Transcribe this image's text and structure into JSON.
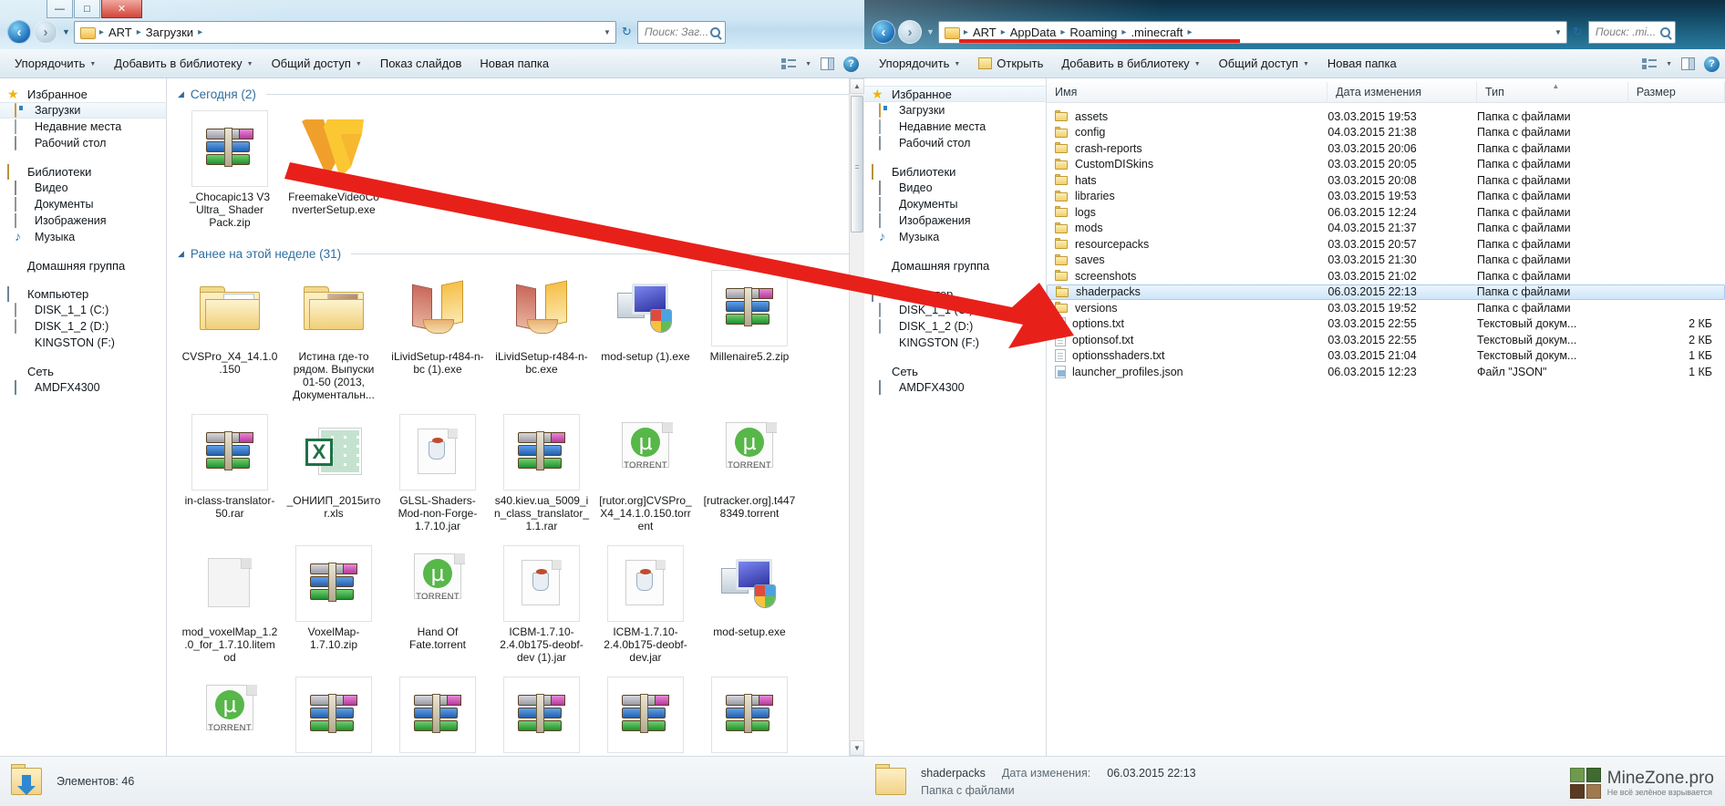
{
  "left_window": {
    "address": {
      "crumbs": [
        "ART",
        "Загрузки"
      ],
      "folder_icon": "downloads-folder-icon"
    },
    "search": {
      "placeholder": "Поиск: Заг..."
    },
    "caption": {
      "minimize": "—",
      "maximize": "□",
      "close": "✕"
    },
    "toolbar": [
      {
        "label": "Упорядочить",
        "has_caret": true
      },
      {
        "label": "Добавить в библиотеку",
        "has_caret": true
      },
      {
        "label": "Общий доступ",
        "has_caret": true
      },
      {
        "label": "Показ слайдов",
        "has_caret": false
      },
      {
        "label": "Новая папка",
        "has_caret": false
      }
    ],
    "sidebar": [
      {
        "label": "Избранное",
        "icon": "star-icon",
        "head": true
      },
      {
        "label": "Загрузки",
        "icon": "downloads-icon",
        "selected": true
      },
      {
        "label": "Недавние места",
        "icon": "recent-places-icon"
      },
      {
        "label": "Рабочий стол",
        "icon": "desktop-icon"
      },
      {
        "gap": true
      },
      {
        "label": "Библиотеки",
        "icon": "libraries-icon",
        "head": true
      },
      {
        "label": "Видео",
        "icon": "video-icon"
      },
      {
        "label": "Документы",
        "icon": "documents-icon"
      },
      {
        "label": "Изображения",
        "icon": "pictures-icon"
      },
      {
        "label": "Музыка",
        "icon": "music-icon"
      },
      {
        "gap": true
      },
      {
        "label": "Домашняя группа",
        "icon": "homegroup-icon",
        "head": true
      },
      {
        "gap": true
      },
      {
        "label": "Компьютер",
        "icon": "computer-icon",
        "head": true
      },
      {
        "label": "DISK_1_1 (C:)",
        "icon": "system-drive-icon"
      },
      {
        "label": "DISK_1_2 (D:)",
        "icon": "hard-drive-icon"
      },
      {
        "label": "KINGSTON (F:)",
        "icon": "usb-drive-icon"
      },
      {
        "gap": true
      },
      {
        "label": "Сеть",
        "icon": "network-icon",
        "head": true
      },
      {
        "label": "AMDFX4300",
        "icon": "network-computer-icon"
      }
    ],
    "groups": [
      {
        "title": "Сегодня (2)",
        "items": [
          {
            "name": "_Chocapic13 V3 Ultra_ Shader Pack.zip",
            "icon": "rar-archive-icon",
            "framed": true
          },
          {
            "name": "FreemakeVideoConverterSetup.exe",
            "icon": "freemake-icon",
            "framed": false
          }
        ]
      },
      {
        "title": "Ранее на этой неделе (31)",
        "items": [
          {
            "name": "CVSPro_X4_14.1.0.150",
            "icon": "folder-icon",
            "framed": false
          },
          {
            "name": "Истина где-то рядом. Выпуски 01-50 (2013, Документальн...",
            "icon": "folder-icon",
            "framed": false
          },
          {
            "name": "iLividSetup-r484-n-bc (1).exe",
            "icon": "film-icon",
            "framed": false
          },
          {
            "name": "iLividSetup-r484-n-bc.exe",
            "icon": "film-icon",
            "framed": false
          },
          {
            "name": "mod-setup (1).exe",
            "icon": "installer-icon",
            "framed": false
          },
          {
            "name": "Millenaire5.2.zip",
            "icon": "rar-archive-icon",
            "framed": true
          },
          {
            "name": "in-class-translator-50.rar",
            "icon": "rar-archive-icon",
            "framed": true
          },
          {
            "name": "_ОНИИП_2015итor.xls",
            "icon": "excel-icon",
            "framed": false
          },
          {
            "name": "GLSL-Shaders-Mod-non-Forge-1.7.10.jar",
            "icon": "jar-icon",
            "framed": true
          },
          {
            "name": "s40.kiev.ua_5009_in_class_translator_1.1.rar",
            "icon": "rar-archive-icon",
            "framed": true
          },
          {
            "name": "[rutor.org]CVSPro_X4_14.1.0.150.torrent",
            "icon": "torrent-icon",
            "framed": false
          },
          {
            "name": "[rutracker.org].t4478349.torrent",
            "icon": "torrent-icon",
            "framed": false
          },
          {
            "name": "mod_voxelMap_1.2.0_for_1.7.10.litemod",
            "icon": "blank-file-icon",
            "framed": false
          },
          {
            "name": "VoxelMap-1.7.10.zip",
            "icon": "rar-archive-icon",
            "framed": true
          },
          {
            "name": "Hand Of Fate.torrent",
            "icon": "torrent-icon",
            "framed": false
          },
          {
            "name": "ICBM-1.7.10-2.4.0b175-deobf-dev (1).jar",
            "icon": "jar-icon",
            "framed": true
          },
          {
            "name": "ICBM-1.7.10-2.4.0b175-deobf-dev.jar",
            "icon": "jar-icon",
            "framed": true
          },
          {
            "name": "mod-setup.exe",
            "icon": "installer-icon",
            "framed": false
          },
          {
            "name": "",
            "icon": "torrent-icon",
            "framed": false
          },
          {
            "name": "",
            "icon": "rar-archive-icon",
            "framed": true
          },
          {
            "name": "",
            "icon": "rar-archive-icon",
            "framed": true
          },
          {
            "name": "",
            "icon": "rar-archive-icon",
            "framed": true
          },
          {
            "name": "",
            "icon": "rar-archive-icon",
            "framed": true
          },
          {
            "name": "",
            "icon": "rar-archive-icon",
            "framed": true
          }
        ]
      }
    ],
    "status": {
      "text": "Элементов: 46",
      "icon": "downloads-folder-icon"
    }
  },
  "right_window": {
    "address": {
      "crumbs": [
        "ART",
        "AppData",
        "Roaming",
        ".minecraft"
      ],
      "highlighted": true
    },
    "search": {
      "placeholder": "Поиск: .mi..."
    },
    "toolbar": [
      {
        "label": "Упорядочить",
        "has_caret": true
      },
      {
        "label": "Открыть",
        "has_caret": false,
        "icon": "open-folder-icon"
      },
      {
        "label": "Добавить в библиотеку",
        "has_caret": true
      },
      {
        "label": "Общий доступ",
        "has_caret": true
      },
      {
        "label": "Новая папка",
        "has_caret": false
      }
    ],
    "sidebar": [
      {
        "label": "Избранное",
        "icon": "star-icon",
        "head": true,
        "selected": true
      },
      {
        "label": "Загрузки",
        "icon": "downloads-icon"
      },
      {
        "label": "Недавние места",
        "icon": "recent-places-icon"
      },
      {
        "label": "Рабочий стол",
        "icon": "desktop-icon"
      },
      {
        "gap": true
      },
      {
        "label": "Библиотеки",
        "icon": "libraries-icon",
        "head": true
      },
      {
        "label": "Видео",
        "icon": "video-icon"
      },
      {
        "label": "Документы",
        "icon": "documents-icon"
      },
      {
        "label": "Изображения",
        "icon": "pictures-icon"
      },
      {
        "label": "Музыка",
        "icon": "music-icon"
      },
      {
        "gap": true
      },
      {
        "label": "Домашняя группа",
        "icon": "homegroup-icon",
        "head": true
      },
      {
        "gap": true
      },
      {
        "label": "Компьютер",
        "icon": "computer-icon",
        "head": true
      },
      {
        "label": "DISK_1_1 (C:)",
        "icon": "system-drive-icon"
      },
      {
        "label": "DISK_1_2 (D:)",
        "icon": "hard-drive-icon"
      },
      {
        "label": "KINGSTON (F:)",
        "icon": "usb-drive-icon"
      },
      {
        "gap": true
      },
      {
        "label": "Сеть",
        "icon": "network-icon",
        "head": true
      },
      {
        "label": "AMDFX4300",
        "icon": "network-computer-icon"
      }
    ],
    "columns": [
      "Имя",
      "Дата изменения",
      "Тип",
      "Размер"
    ],
    "rows": [
      {
        "name": "assets",
        "icon": "folder-icon",
        "date": "03.03.2015 19:53",
        "type": "Папка с файлами",
        "size": ""
      },
      {
        "name": "config",
        "icon": "folder-icon",
        "date": "04.03.2015 21:38",
        "type": "Папка с файлами",
        "size": ""
      },
      {
        "name": "crash-reports",
        "icon": "folder-icon",
        "date": "03.03.2015 20:06",
        "type": "Папка с файлами",
        "size": ""
      },
      {
        "name": "CustomDISkins",
        "icon": "folder-icon",
        "date": "03.03.2015 20:05",
        "type": "Папка с файлами",
        "size": ""
      },
      {
        "name": "hats",
        "icon": "folder-icon",
        "date": "03.03.2015 20:08",
        "type": "Папка с файлами",
        "size": ""
      },
      {
        "name": "libraries",
        "icon": "folder-icon",
        "date": "03.03.2015 19:53",
        "type": "Папка с файлами",
        "size": ""
      },
      {
        "name": "logs",
        "icon": "folder-icon",
        "date": "06.03.2015 12:24",
        "type": "Папка с файлами",
        "size": ""
      },
      {
        "name": "mods",
        "icon": "folder-icon",
        "date": "04.03.2015 21:37",
        "type": "Папка с файлами",
        "size": ""
      },
      {
        "name": "resourcepacks",
        "icon": "folder-icon",
        "date": "03.03.2015 20:57",
        "type": "Папка с файлами",
        "size": ""
      },
      {
        "name": "saves",
        "icon": "folder-icon",
        "date": "03.03.2015 21:30",
        "type": "Папка с файлами",
        "size": ""
      },
      {
        "name": "screenshots",
        "icon": "folder-icon",
        "date": "03.03.2015 21:02",
        "type": "Папка с файлами",
        "size": ""
      },
      {
        "name": "shaderpacks",
        "icon": "folder-icon",
        "date": "06.03.2015 22:13",
        "type": "Папка с файлами",
        "size": "",
        "selected": true
      },
      {
        "name": "versions",
        "icon": "folder-icon",
        "date": "03.03.2015 19:52",
        "type": "Папка с файлами",
        "size": ""
      },
      {
        "name": "options.txt",
        "icon": "text-file-icon",
        "date": "03.03.2015 22:55",
        "type": "Текстовый докум...",
        "size": "2 КБ"
      },
      {
        "name": "optionsof.txt",
        "icon": "text-file-icon",
        "date": "03.03.2015 22:55",
        "type": "Текстовый докум...",
        "size": "2 КБ"
      },
      {
        "name": "optionsshaders.txt",
        "icon": "text-file-icon",
        "date": "03.03.2015 21:04",
        "type": "Текстовый докум...",
        "size": "1 КБ"
      },
      {
        "name": "launcher_profiles.json",
        "icon": "json-file-icon",
        "date": "06.03.2015 12:23",
        "type": "Файл \"JSON\"",
        "size": "1 КБ"
      }
    ],
    "status": {
      "name": "shaderpacks",
      "date_label": "Дата изменения:",
      "date_value": "06.03.2015 22:13",
      "type": "Папка с файлами",
      "icon": "folder-icon"
    }
  },
  "watermark": {
    "title": "MineZone.pro",
    "tagline": "Не всё зелёное взрывается"
  },
  "annotation": {
    "arrow_color": "#e8201a",
    "description": "red-arrow-from-shader-zip-to-shaderpacks-folder"
  }
}
